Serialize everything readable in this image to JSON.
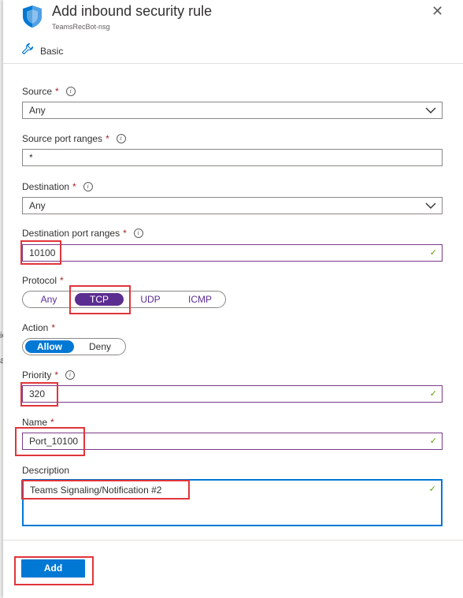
{
  "background": {
    "fragment_1": "io",
    "fragment_2": "a"
  },
  "header": {
    "title": "Add inbound security rule",
    "subtitle": "TeamsRecBot-nsg",
    "close_glyph": "✕"
  },
  "tab": {
    "label": "Basic",
    "icon": "wrench-icon"
  },
  "source": {
    "label": "Source",
    "required_mark": "*",
    "value": "Any"
  },
  "source_port": {
    "label": "Source port ranges",
    "required_mark": "*",
    "value": "*"
  },
  "destination": {
    "label": "Destination",
    "required_mark": "*",
    "value": "Any"
  },
  "destination_port": {
    "label": "Destination port ranges",
    "required_mark": "*",
    "value": "10100"
  },
  "protocol": {
    "label": "Protocol",
    "required_mark": "*",
    "options": [
      "Any",
      "TCP",
      "UDP",
      "ICMP"
    ],
    "selected": "TCP"
  },
  "action": {
    "label": "Action",
    "required_mark": "*",
    "options": [
      "Allow",
      "Deny"
    ],
    "selected": "Allow"
  },
  "priority": {
    "label": "Priority",
    "required_mark": "*",
    "value": "320"
  },
  "name": {
    "label": "Name",
    "required_mark": "*",
    "value": "Port_10100"
  },
  "description": {
    "label": "Description",
    "value": "Teams Signaling/Notification #2"
  },
  "footer": {
    "add_label": "Add"
  },
  "colors": {
    "accent": "#0078d4",
    "selected_segment": "#5c2d91",
    "required": "#a4262c",
    "valid_check": "#57a300",
    "highlight_box": "#e0353b"
  },
  "info_glyph": "i",
  "check_glyph": "✓"
}
